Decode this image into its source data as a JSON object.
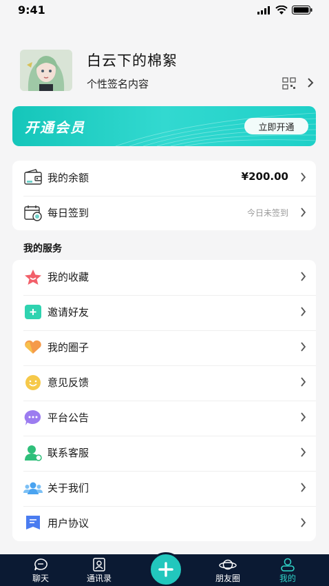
{
  "status": {
    "time": "9:41"
  },
  "profile": {
    "name": "白云下的棉絮",
    "signature": "个性签名内容"
  },
  "vip": {
    "title": "开通会员",
    "button": "立即开通"
  },
  "wallet": [
    {
      "label": "我的余额",
      "value": "¥200.00",
      "icon": "wallet-icon"
    },
    {
      "label": "每日签到",
      "value": "今日未签到",
      "icon": "calendar-checkin-icon"
    }
  ],
  "services": {
    "title": "我的服务",
    "items": [
      {
        "label": "我的收藏",
        "icon": "star-icon"
      },
      {
        "label": "邀请好友",
        "icon": "invite-icon"
      },
      {
        "label": "我的圈子",
        "icon": "heart-circle-icon"
      },
      {
        "label": "意见反馈",
        "icon": "smile-feedback-icon"
      },
      {
        "label": "平台公告",
        "icon": "chat-bubble-icon"
      },
      {
        "label": "联系客服",
        "icon": "customer-service-icon"
      },
      {
        "label": "关于我们",
        "icon": "team-icon"
      },
      {
        "label": "用户协议",
        "icon": "agreement-icon"
      }
    ]
  },
  "tabbar": {
    "items": [
      {
        "label": "聊天",
        "icon": "chat-icon"
      },
      {
        "label": "通讯录",
        "icon": "contacts-icon"
      },
      {
        "label": "朋友圈",
        "icon": "planet-icon"
      },
      {
        "label": "我的",
        "icon": "person-icon"
      }
    ],
    "active": "我的"
  },
  "colors": {
    "accent": "#22c7bd",
    "tabbar_bg": "#0b1a33"
  }
}
